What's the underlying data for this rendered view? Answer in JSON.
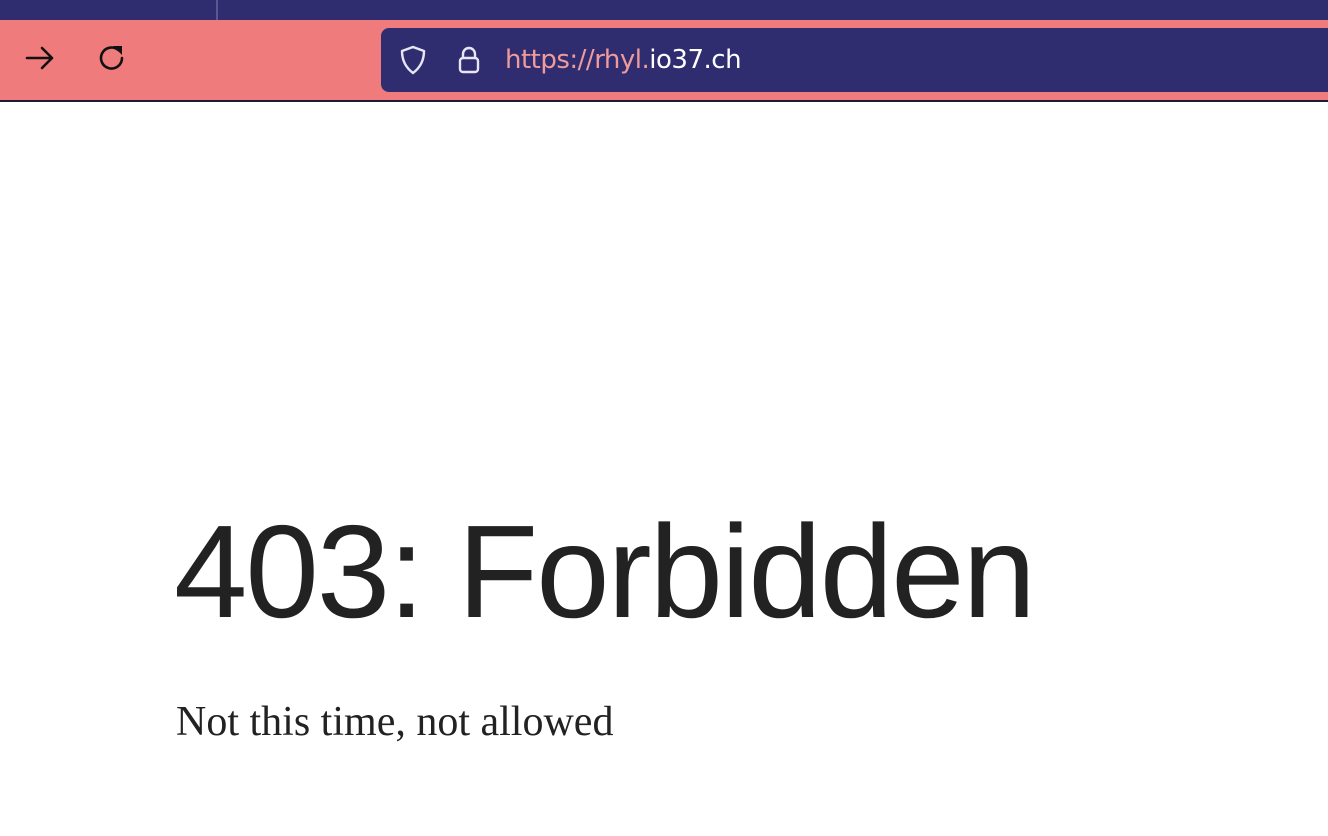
{
  "browser": {
    "url": {
      "scheme": "https://",
      "subdomain": "rhyl.",
      "domain": "io37.ch"
    },
    "icons": {
      "forward": "arrow-right-icon",
      "reload": "reload-icon",
      "tracking_protection": "shield-icon",
      "security": "lock-icon"
    },
    "colors": {
      "tabstrip": "#2f2d70",
      "toolbar": "#ef7b7c",
      "urlbar": "#2f2d70",
      "url_muted": "#ef9a9b",
      "url_domain": "#ffffff"
    }
  },
  "page": {
    "heading": "403: Forbidden",
    "message": "Not this time, not allowed"
  }
}
